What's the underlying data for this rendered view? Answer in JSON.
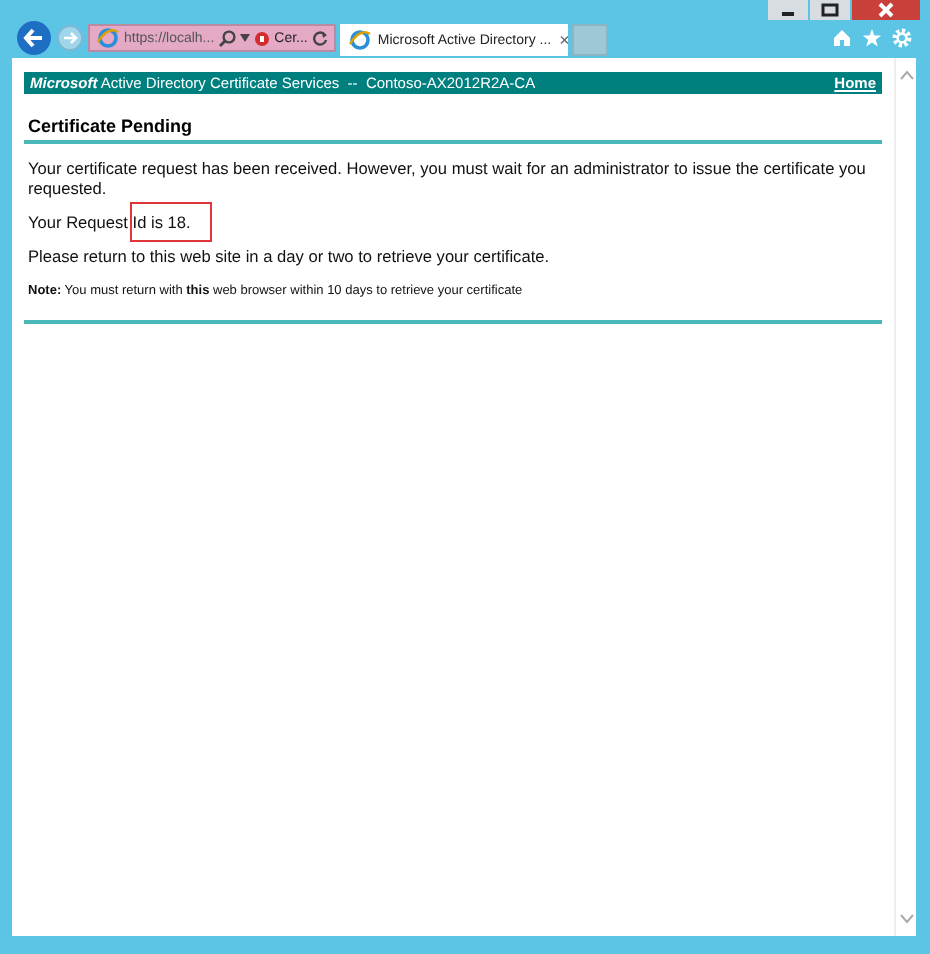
{
  "toolbar": {
    "address": "https://localh...",
    "tabs": [
      {
        "label": "Cer...",
        "selected": false,
        "kind": "address"
      },
      {
        "label": "Microsoft Active Directory ...",
        "selected": true,
        "kind": "tab",
        "close": "×"
      },
      {
        "selected": false,
        "kind": "new"
      }
    ]
  },
  "banner": {
    "brand": "Microsoft",
    "title": "Active Directory Certificate Services  --  Contoso-AX2012R2A-CA",
    "link": "Home"
  },
  "heading": "Certificate Pending",
  "paragraphs": [
    {
      "text": "Your certificate request has been received. However, you must wait for an administrator to issue the certificate you requested.",
      "highlighted": false
    },
    {
      "text": "Your Request Id is 18.",
      "highlighted": true
    },
    {
      "text": "Please return to this web site in a day or two to retrieve your certificate.",
      "highlighted": false
    }
  ],
  "note": "**Note:** You must return with **this** web browser within 10 days to retrieve your certificate"
}
